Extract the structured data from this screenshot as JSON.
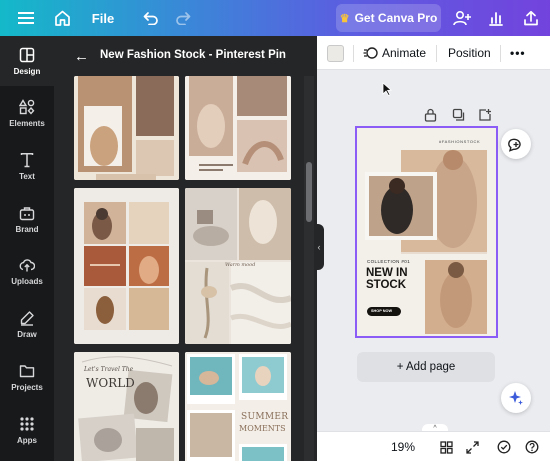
{
  "topbar": {
    "file_label": "File",
    "get_pro_label": "Get Canva Pro",
    "icons": [
      "menu-icon",
      "home-icon",
      "undo-icon",
      "redo-icon",
      "share-people-icon",
      "insights-icon",
      "upload-icon"
    ]
  },
  "rail": {
    "items": [
      {
        "label": "Design",
        "icon": "design-icon"
      },
      {
        "label": "Elements",
        "icon": "elements-icon"
      },
      {
        "label": "Text",
        "icon": "text-icon"
      },
      {
        "label": "Brand",
        "icon": "brand-icon"
      },
      {
        "label": "Uploads",
        "icon": "uploads-icon"
      },
      {
        "label": "Draw",
        "icon": "draw-icon"
      },
      {
        "label": "Projects",
        "icon": "projects-icon"
      },
      {
        "label": "Apps",
        "icon": "apps-icon"
      }
    ]
  },
  "panel": {
    "title": "New Fashion Stock - Pinterest Pin",
    "thumb_texts": {
      "world_title": "WORLD",
      "world_sub": "Let's Travel The",
      "summer": "SUMMER",
      "moments": "MOMENTS",
      "script": "Warm mood"
    }
  },
  "editor": {
    "animate_label": "Animate",
    "position_label": "Position",
    "more_label": "•••",
    "add_page_label": "+ Add page",
    "swatch_color": "#eceae4",
    "selection_color": "#8b5cf6"
  },
  "design": {
    "tag_line": "#FASHIONSTOCK",
    "collection_label": "COLLECTION #01",
    "headline_line1": "NEW IN",
    "headline_line2": "STOCK",
    "cta_label": "SHOP NOW"
  },
  "footer": {
    "zoom": "19%",
    "tab_glyph": "^"
  }
}
